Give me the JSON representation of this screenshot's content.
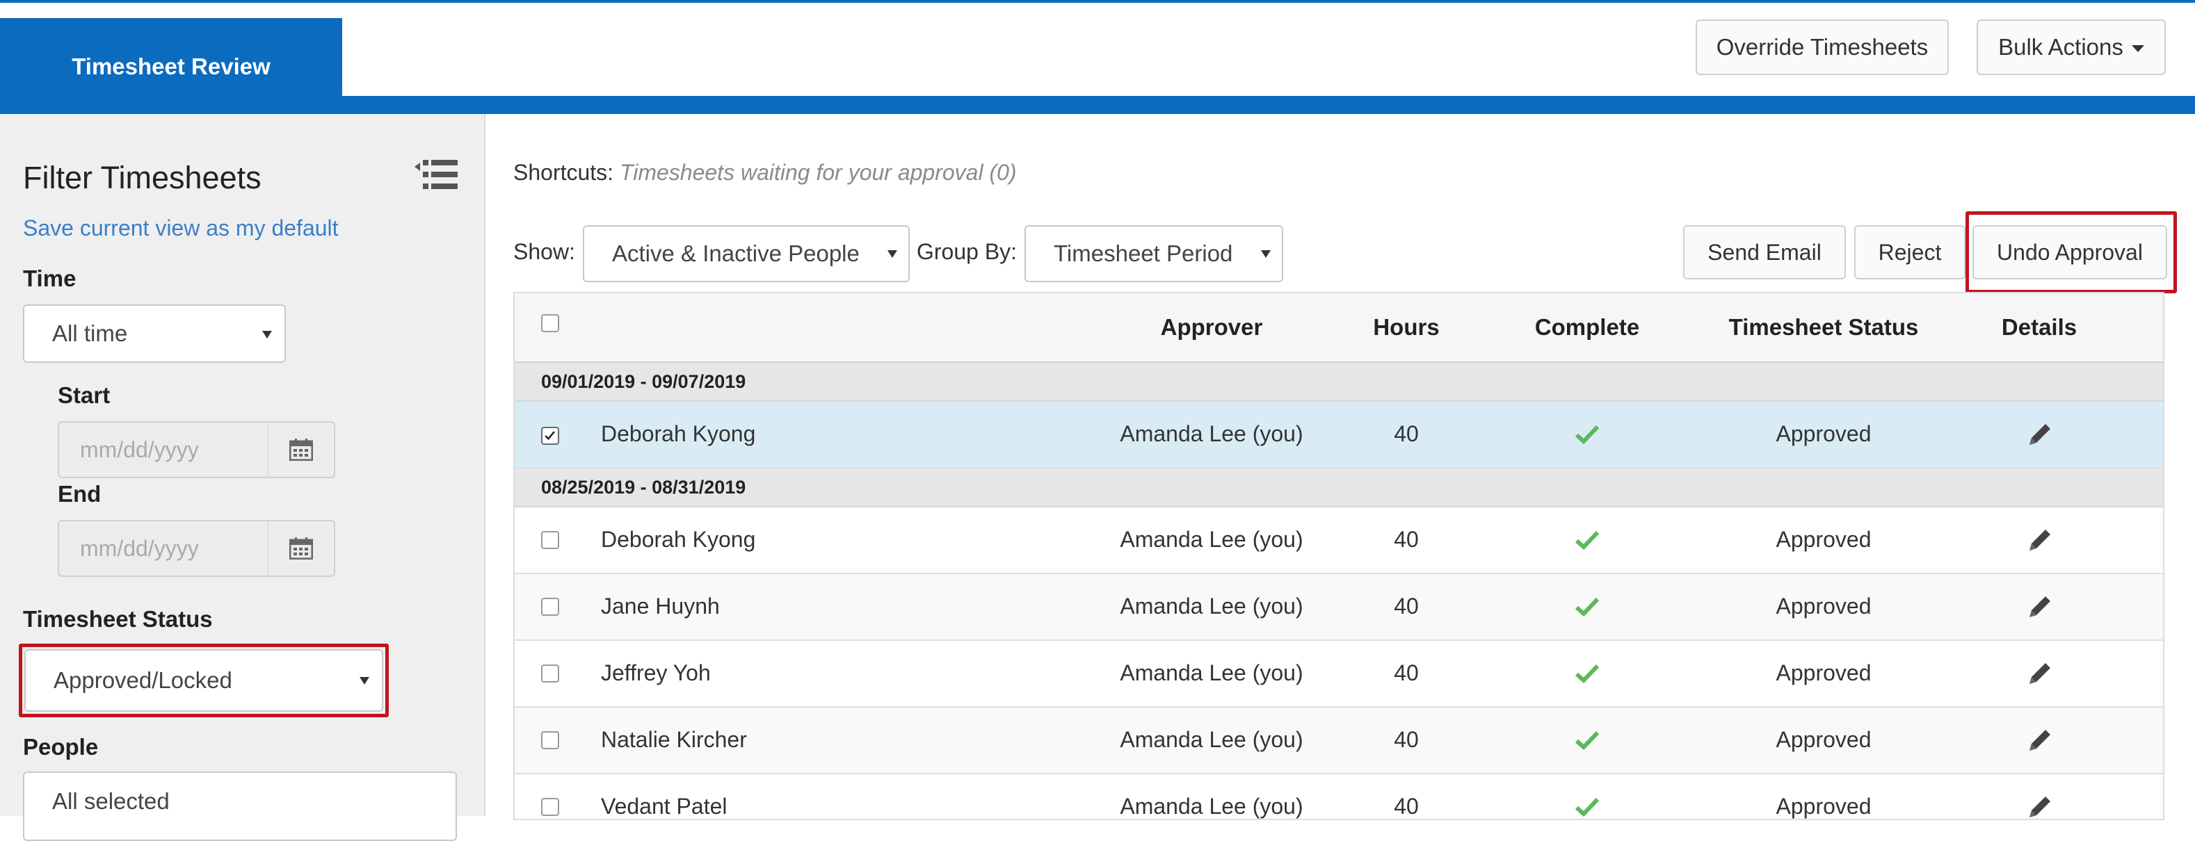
{
  "header": {
    "active_tab": "Timesheet Review",
    "override_button": "Override Timesheets",
    "bulk_actions_button": "Bulk Actions"
  },
  "sidebar": {
    "title": "Filter Timesheets",
    "save_default_link": "Save current view as my default",
    "time_label": "Time",
    "time_value": "All time",
    "start_label": "Start",
    "start_placeholder": "mm/dd/yyyy",
    "end_label": "End",
    "end_placeholder": "mm/dd/yyyy",
    "status_label": "Timesheet Status",
    "status_value": "Approved/Locked",
    "people_label": "People",
    "people_value": "All selected"
  },
  "main": {
    "shortcuts_label": "Shortcuts:",
    "shortcuts_text": "Timesheets waiting for your approval (0)",
    "show_label": "Show:",
    "show_value": "Active & Inactive People",
    "group_by_label": "Group By:",
    "group_by_value": "Timesheet Period",
    "send_email_button": "Send Email",
    "reject_button": "Reject",
    "undo_approval_button": "Undo Approval"
  },
  "table": {
    "columns": [
      "Approver",
      "Hours",
      "Complete",
      "Timesheet Status",
      "Details"
    ],
    "groups": [
      {
        "period": "09/01/2019 - 09/07/2019",
        "rows": [
          {
            "name": "Deborah Kyong",
            "approver": "Amanda Lee (you)",
            "hours": "40",
            "complete": true,
            "status": "Approved",
            "checked": true
          }
        ]
      },
      {
        "period": "08/25/2019 - 08/31/2019",
        "rows": [
          {
            "name": "Deborah Kyong",
            "approver": "Amanda Lee (you)",
            "hours": "40",
            "complete": true,
            "status": "Approved",
            "checked": false
          },
          {
            "name": "Jane Huynh",
            "approver": "Amanda Lee (you)",
            "hours": "40",
            "complete": true,
            "status": "Approved",
            "checked": false
          },
          {
            "name": "Jeffrey Yoh",
            "approver": "Amanda Lee (you)",
            "hours": "40",
            "complete": true,
            "status": "Approved",
            "checked": false
          },
          {
            "name": "Natalie Kircher",
            "approver": "Amanda Lee (you)",
            "hours": "40",
            "complete": true,
            "status": "Approved",
            "checked": false
          },
          {
            "name": "Vedant Patel",
            "approver": "Amanda Lee (you)",
            "hours": "40",
            "complete": true,
            "status": "Approved",
            "checked": false
          }
        ]
      }
    ]
  },
  "colors": {
    "brand_blue": "#0b6bbf",
    "highlight_red": "#c0151e",
    "check_green": "#5cb85c",
    "selected_row": "#d9ecf5"
  }
}
